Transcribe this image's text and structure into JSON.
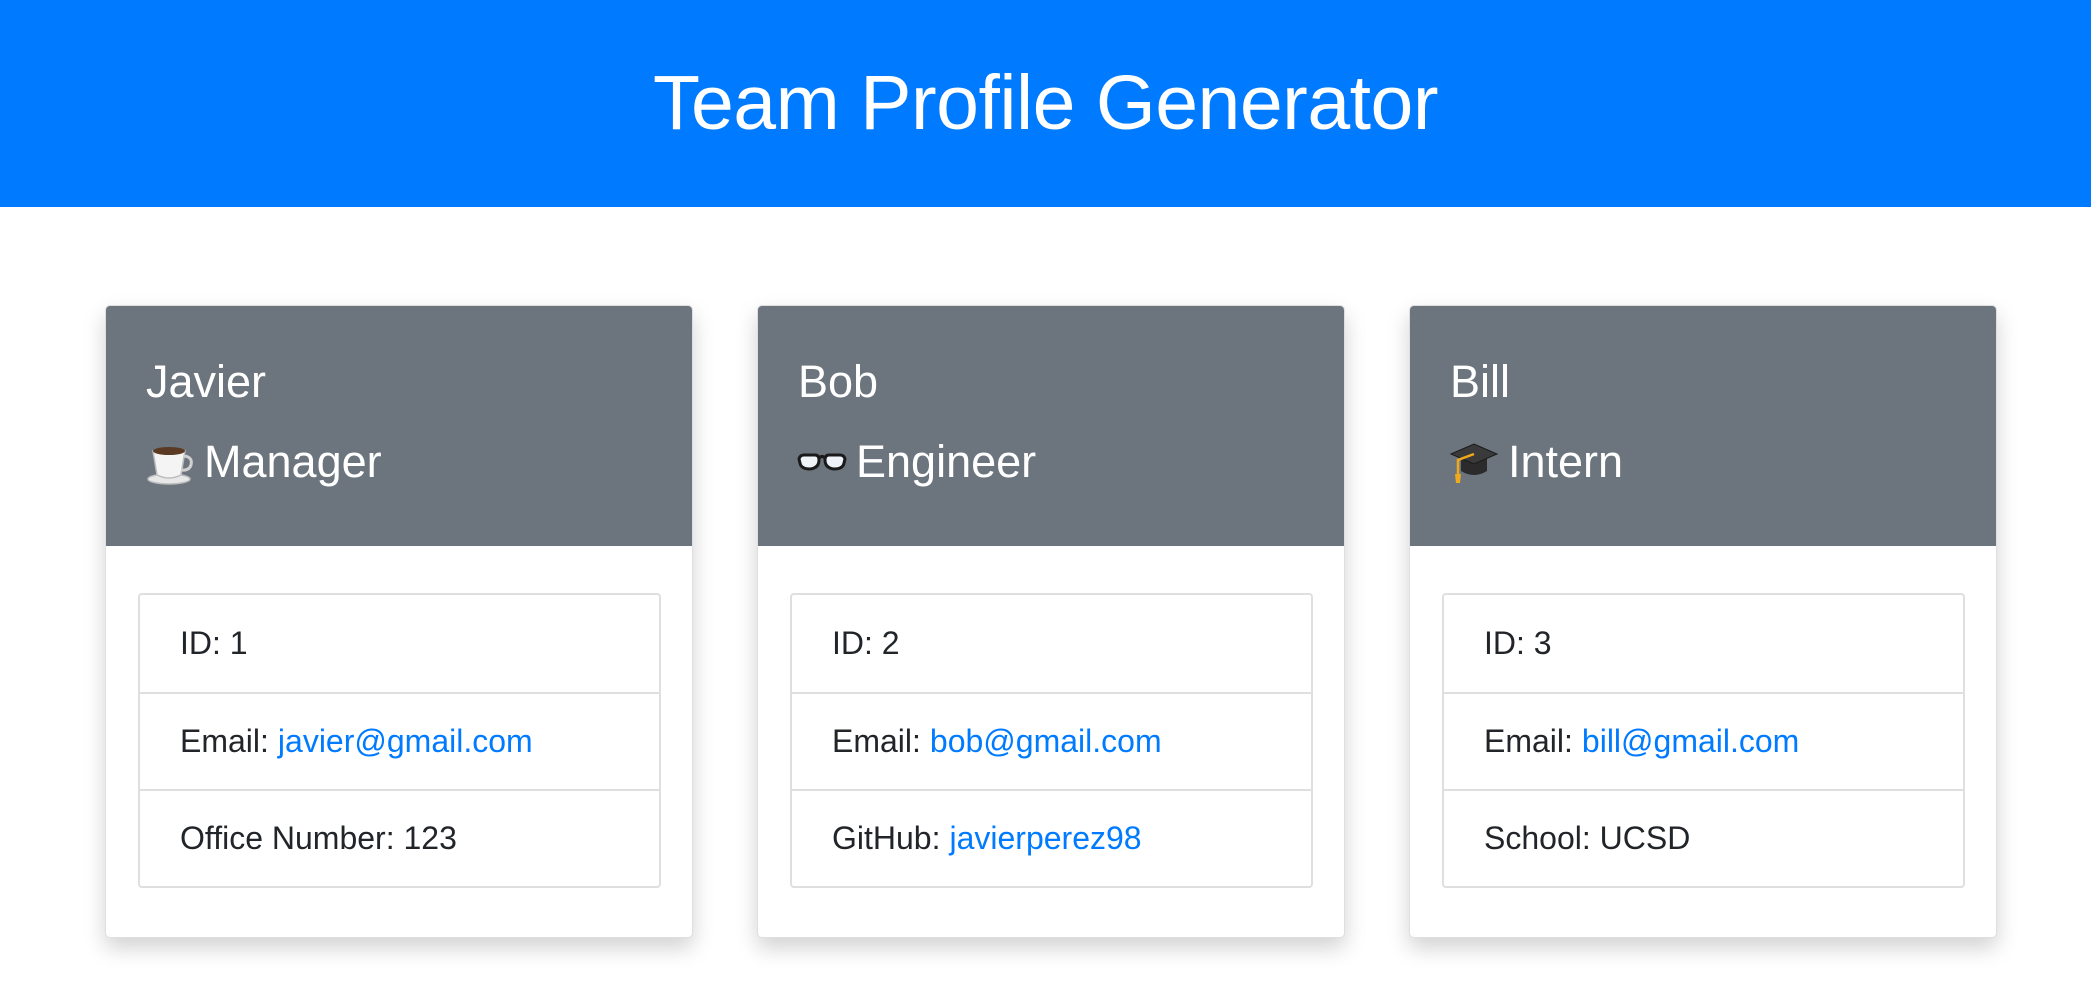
{
  "header": {
    "title": "Team Profile Generator",
    "background_color": "#007bff"
  },
  "colors": {
    "card_header": "#6c757d",
    "link": "#007bff"
  },
  "employees": [
    {
      "name": "Javier",
      "role": "Manager",
      "role_icon": "coffee-icon",
      "id_label": "ID: 1",
      "email_label": "Email:",
      "email": "javier@gmail.com",
      "extra_label": "Office Number: 123",
      "extra_link": ""
    },
    {
      "name": "Bob",
      "role": "Engineer",
      "role_icon": "glasses-icon",
      "id_label": "ID: 2",
      "email_label": "Email:",
      "email": "bob@gmail.com",
      "extra_label": "GitHub:",
      "extra_link": "javierperez98"
    },
    {
      "name": "Bill",
      "role": "Intern",
      "role_icon": "graduation-cap-icon",
      "id_label": "ID: 3",
      "email_label": "Email:",
      "email": "bill@gmail.com",
      "extra_label": "School: UCSD",
      "extra_link": ""
    }
  ]
}
